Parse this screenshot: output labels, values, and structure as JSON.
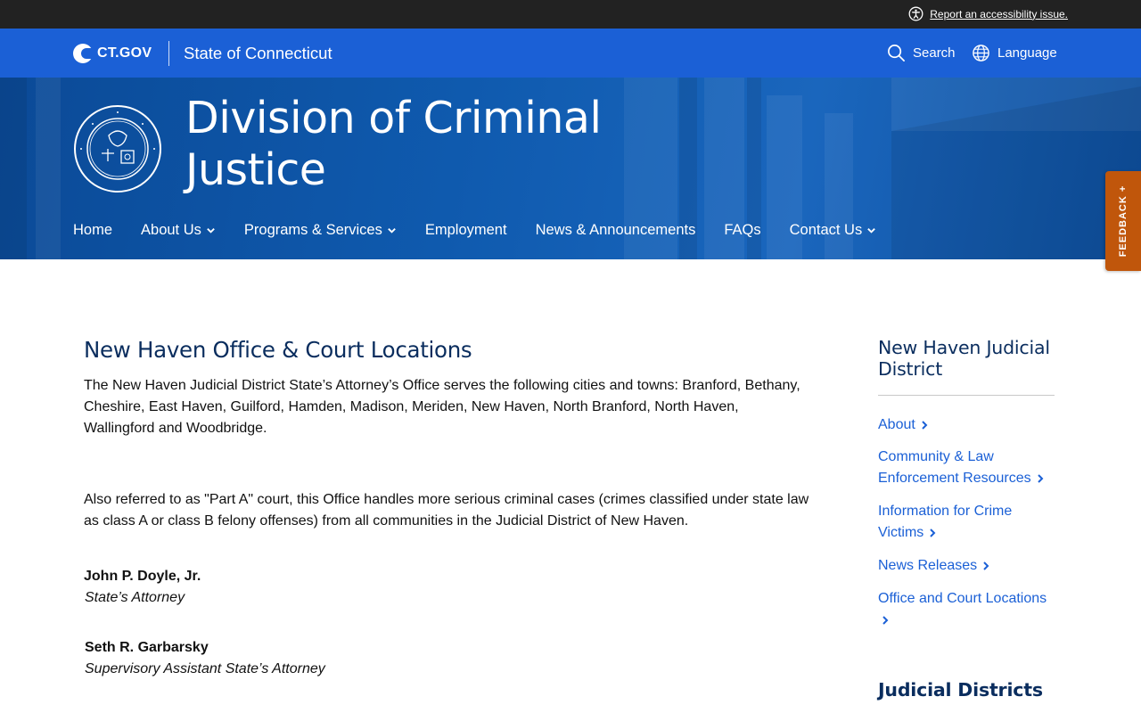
{
  "utility": {
    "accessibility_link": "Report an accessibility issue."
  },
  "ct_header": {
    "logo_text": "CT.GOV",
    "state_name": "State of Connecticut",
    "search_label": "Search",
    "language_label": "Language"
  },
  "agency": {
    "title": "Division of Criminal Justice",
    "seal_alt": "seal-icon"
  },
  "nav": {
    "items": [
      {
        "label": "Home",
        "has_dropdown": false
      },
      {
        "label": "About Us",
        "has_dropdown": true
      },
      {
        "label": "Programs & Services",
        "has_dropdown": true
      },
      {
        "label": "Employment",
        "has_dropdown": false
      },
      {
        "label": "News & Announcements",
        "has_dropdown": false
      },
      {
        "label": "FAQs",
        "has_dropdown": false
      },
      {
        "label": "Contact Us",
        "has_dropdown": true
      }
    ]
  },
  "feedback": {
    "label": "FEEDBACK +"
  },
  "main": {
    "title": "New Haven Office & Court Locations",
    "paragraph1": "The New Haven Judicial District State’s Attorney’s Office serves the following cities and towns: Branford, Bethany, Cheshire, East Haven, Guilford, Hamden, Madison, Meriden, New Haven, North Branford, North Haven, Wallingford and Woodbridge.",
    "paragraph2": "Also referred to as \"Part A\" court, this Office handles more serious criminal cases (crimes classified under state law as class A or class B felony offenses) from all communities in the Judicial District of New Haven.",
    "people": [
      {
        "name": "John P. Doyle, Jr.",
        "role": "State’s Attorney"
      },
      {
        "name": "Seth R. Garbarsky",
        "role": "Supervisory Assistant State’s Attorney"
      }
    ]
  },
  "sidebar": {
    "title": "New Haven Judicial District",
    "links": [
      {
        "label": "About"
      },
      {
        "label": "Community & Law Enforcement Resources"
      },
      {
        "label": "Information for Crime Victims"
      },
      {
        "label": "News Releases"
      },
      {
        "label": "Office and Court Locations"
      }
    ],
    "section2_title": "Judicial Districts"
  },
  "colors": {
    "ct_blue": "#1b60d6",
    "hero_blue": "#0f5aae",
    "heading_navy": "#0a2d5e",
    "feedback_orange": "#c0560b"
  }
}
